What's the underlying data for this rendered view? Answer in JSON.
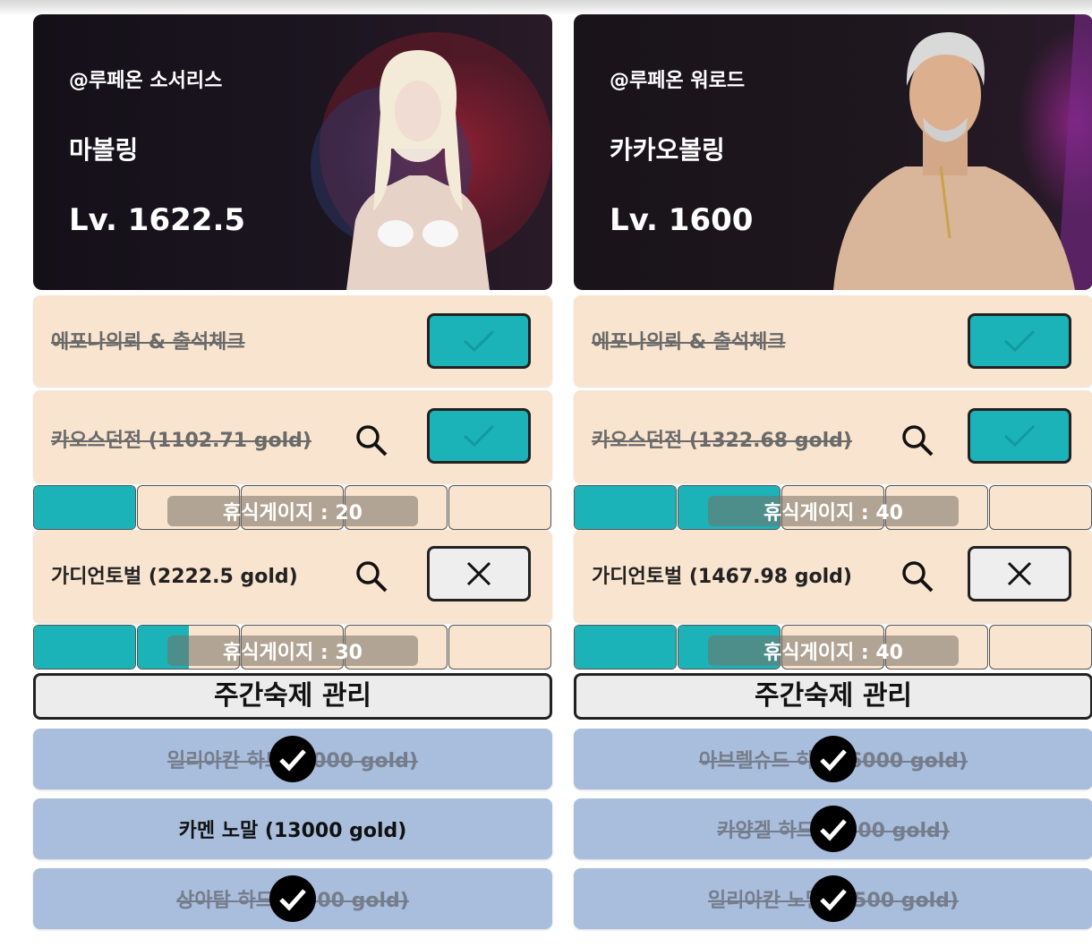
{
  "colors": {
    "teal": "#1bb3b8",
    "card_bg": "#f9e4cf",
    "raid_bg": "#a9bddc",
    "dark_border": "#222222"
  },
  "characters": [
    {
      "server_class": "@루페온 소서리스",
      "name": "마볼링",
      "level": "Lv. 1622.5",
      "epona": {
        "label": "에포나의뢰 & 출석체크",
        "done": true
      },
      "chaos": {
        "label": "카오스던전 (1102.71 gold)",
        "done": true,
        "gauge_label": "휴식게이지 : 20",
        "gauge_value": 20
      },
      "guardian": {
        "label": "가디언토벌 (2222.5 gold)",
        "done": false,
        "gauge_label": "휴식게이지 : 30",
        "gauge_value": 30
      },
      "weekly_button": "주간숙제 관리",
      "raids": [
        {
          "label": "일리아칸 하드 (9000 gold)",
          "done": true
        },
        {
          "label": "카멘 노말 (13000 gold)",
          "done": false
        },
        {
          "label": "상아탑 하드 (7500 gold)",
          "done": true
        }
      ]
    },
    {
      "server_class": "@루페온 워로드",
      "name": "카카오볼링",
      "level": "Lv. 1600",
      "epona": {
        "label": "에포나의뢰 & 출석체크",
        "done": true
      },
      "chaos": {
        "label": "카오스던전 (1322.68 gold)",
        "done": true,
        "gauge_label": "휴식게이지 : 40",
        "gauge_value": 40
      },
      "guardian": {
        "label": "가디언토벌 (1467.98 gold)",
        "done": false,
        "gauge_label": "휴식게이지 : 40",
        "gauge_value": 40
      },
      "weekly_button": "주간숙제 관리",
      "raids": [
        {
          "label": "아브렐슈드 하드 (6000 gold)",
          "done": true
        },
        {
          "label": "카양겔 하드 (4500 gold)",
          "done": true
        },
        {
          "label": "일리아칸 노말 (5500 gold)",
          "done": true
        }
      ]
    }
  ],
  "icons": {
    "check": "check-icon",
    "cross": "close-icon",
    "search": "search-icon",
    "done_badge": "check-circle-icon"
  }
}
